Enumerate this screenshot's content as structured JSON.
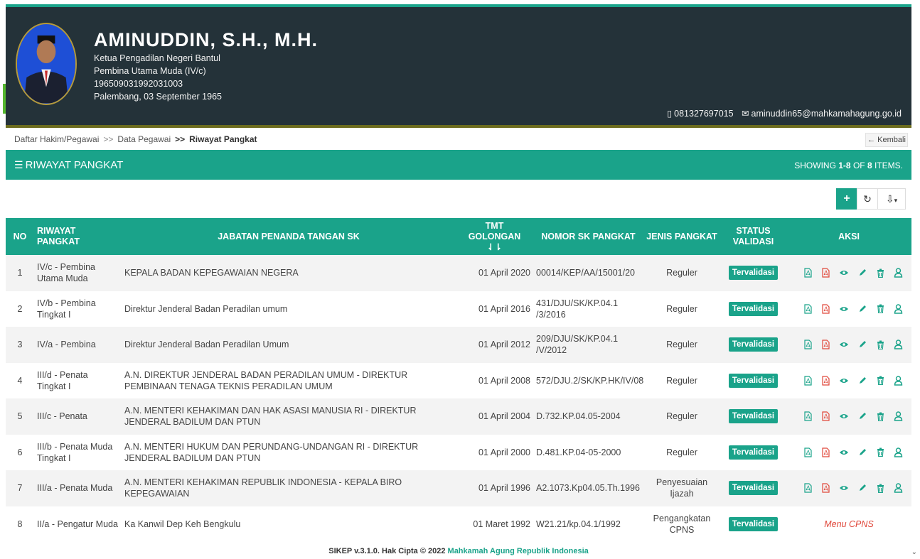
{
  "profile": {
    "name": "AMINUDDIN, S.H., M.H.",
    "position": "Ketua Pengadilan Negeri Bantul",
    "rank": "Pembina Utama Muda (IV/c)",
    "nip": "196509031992031003",
    "birth": "Palembang, 03 September 1965",
    "phone": "081327697015",
    "email": "aminuddin65@mahkamahagung.go.id"
  },
  "breadcrumb": {
    "items": [
      "Daftar Hakim/Pegawai",
      "Data Pegawai"
    ],
    "separator": ">>",
    "current": "Riwayat Pangkat",
    "back_label": "Kembali"
  },
  "panel": {
    "title": "RIWAYAT PANGKAT",
    "summary_prefix": "SHOWING",
    "summary_range": "1-8",
    "summary_of": "OF",
    "summary_total": "8",
    "summary_suffix": "ITEMS."
  },
  "table": {
    "headers": {
      "no": "NO",
      "riwayat": "RIWAYAT PANGKAT",
      "jabatan": "JABATAN PENANDA TANGAN SK",
      "tmt": "TMT GOLONGAN",
      "nomor": "NOMOR SK PANGKAT",
      "jenis": "JENIS PANGKAT",
      "status": "STATUS VALIDASI",
      "aksi": "AKSI"
    },
    "rows": [
      {
        "no": "1",
        "riwayat": "IV/c - Pembina Utama Muda",
        "jabatan": "KEPALA BADAN KEPEGAWAIAN NEGERA",
        "tmt": "01 April 2020",
        "nomor": "00014/KEP/AA/15001/20",
        "jenis": "Reguler",
        "status": "Tervalidasi"
      },
      {
        "no": "2",
        "riwayat": "IV/b - Pembina Tingkat I",
        "jabatan": "Direktur Jenderal Badan Peradilan umum",
        "tmt": "01 April 2016",
        "nomor": "431/DJU/SK/KP.04.1 /3/2016",
        "jenis": "Reguler",
        "status": "Tervalidasi"
      },
      {
        "no": "3",
        "riwayat": "IV/a - Pembina",
        "jabatan": "Direktur Jenderal Badan Peradilan Umum",
        "tmt": "01 April 2012",
        "nomor": "209/DJU/SK/KP.04.1 /V/2012",
        "jenis": "Reguler",
        "status": "Tervalidasi"
      },
      {
        "no": "4",
        "riwayat": "III/d - Penata Tingkat I",
        "jabatan": "A.N. DIREKTUR JENDERAL BADAN PERADILAN UMUM - DIREKTUR PEMBINAAN TENAGA TEKNIS PERADILAN UMUM",
        "tmt": "01 April 2008",
        "nomor": "572/DJU.2/SK/KP.HK/IV/08",
        "jenis": "Reguler",
        "status": "Tervalidasi"
      },
      {
        "no": "5",
        "riwayat": "III/c - Penata",
        "jabatan": "A.N. MENTERI KEHAKIMAN DAN HAK ASASI MANUSIA RI - DIREKTUR JENDERAL BADILUM DAN PTUN",
        "tmt": "01 April 2004",
        "nomor": "D.732.KP.04.05-2004",
        "jenis": "Reguler",
        "status": "Tervalidasi"
      },
      {
        "no": "6",
        "riwayat": "III/b - Penata Muda Tingkat I",
        "jabatan": "A.N. MENTERI HUKUM DAN PERUNDANG-UNDANGAN RI - DIREKTUR JENDERAL BADILUM DAN PTUN",
        "tmt": "01 April 2000",
        "nomor": "D.481.KP.04-05-2000",
        "jenis": "Reguler",
        "status": "Tervalidasi"
      },
      {
        "no": "7",
        "riwayat": "III/a - Penata Muda",
        "jabatan": "A.N. MENTERI KEHAKIMAN REPUBLIK INDONESIA - KEPALA BIRO KEPEGAWAIAN",
        "tmt": "01 April 1996",
        "nomor": "A2.1073.Kp04.05.Th.1996",
        "jenis": "Penyesuaian Ijazah",
        "status": "Tervalidasi"
      },
      {
        "no": "8",
        "riwayat": "II/a - Pengatur Muda",
        "jabatan": "Ka Kanwil Dep Keh Bengkulu",
        "tmt": "01 Maret 1992",
        "nomor": "W21.21/kp.04.1/1992",
        "jenis": "Pengangkatan CPNS",
        "status": "Tervalidasi",
        "menu": "Menu CPNS"
      }
    ]
  },
  "footer": {
    "text": "SIKEP v.3.1.0. Hak Cipta © 2022",
    "link": "Mahkamah Agung Republik Indonesia"
  },
  "colors": {
    "accent": "#1aa38a",
    "header_bg": "#243239",
    "danger": "#e0473a"
  }
}
